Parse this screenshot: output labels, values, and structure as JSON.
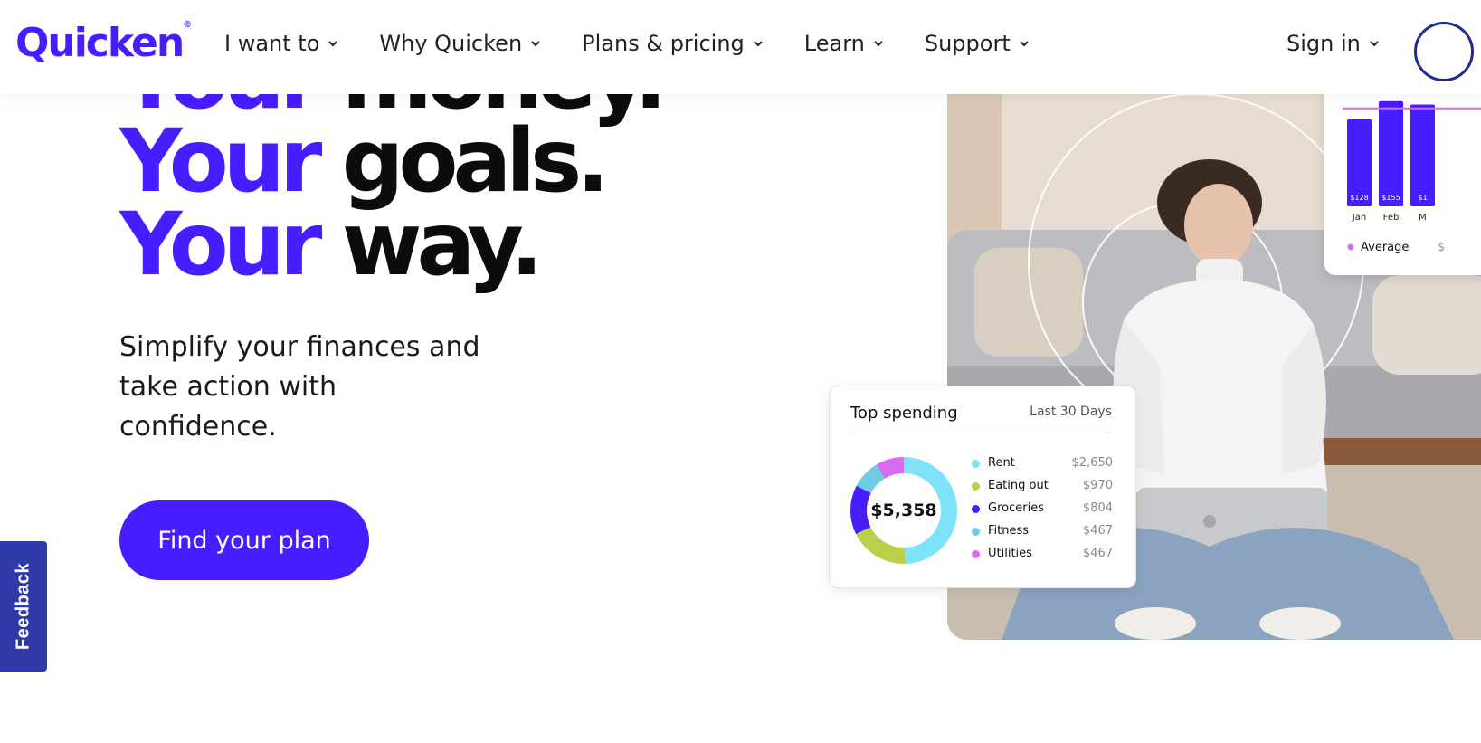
{
  "header": {
    "logo_text": "Quicken",
    "nav": [
      {
        "label": "I want to"
      },
      {
        "label": "Why Quicken"
      },
      {
        "label": "Plans & pricing"
      },
      {
        "label": "Learn"
      },
      {
        "label": "Support"
      }
    ],
    "signin_label": "Sign in"
  },
  "hero": {
    "line1_purple": "Your",
    "line1_black": "money.",
    "line2_purple": "Your",
    "line2_black": "goals.",
    "line3_purple": "Your",
    "line3_black": "way.",
    "subtitle": "Simplify your finances and take action with confidence.",
    "cta_label": "Find your plan"
  },
  "feedback_label": "Feedback",
  "bar_card": {
    "bars": [
      {
        "month": "Jan",
        "value": 128,
        "label": "$128"
      },
      {
        "month": "Feb",
        "value": 155,
        "label": "$155"
      },
      {
        "month": "M",
        "value": 150,
        "label": "$1"
      }
    ],
    "average_label": "Average",
    "average_value_partial": "$"
  },
  "spending_card": {
    "title": "Top spending",
    "range": "Last 30 Days",
    "total": "$5,358",
    "items": [
      {
        "name": "Rent",
        "value": "$2,650",
        "amount": 2650,
        "color": "#7ee3f8"
      },
      {
        "name": "Eating out",
        "value": "$970",
        "amount": 970,
        "color": "#b9d14a"
      },
      {
        "name": "Groceries",
        "value": "$804",
        "amount": 804,
        "color": "#471cff"
      },
      {
        "name": "Fitness",
        "value": "$467",
        "amount": 467,
        "color": "#6fcde3"
      },
      {
        "name": "Utilities",
        "value": "$467",
        "amount": 467,
        "color": "#d66cf0"
      }
    ]
  },
  "colors": {
    "brand": "#471cff",
    "feedback": "#2d3aa8"
  }
}
